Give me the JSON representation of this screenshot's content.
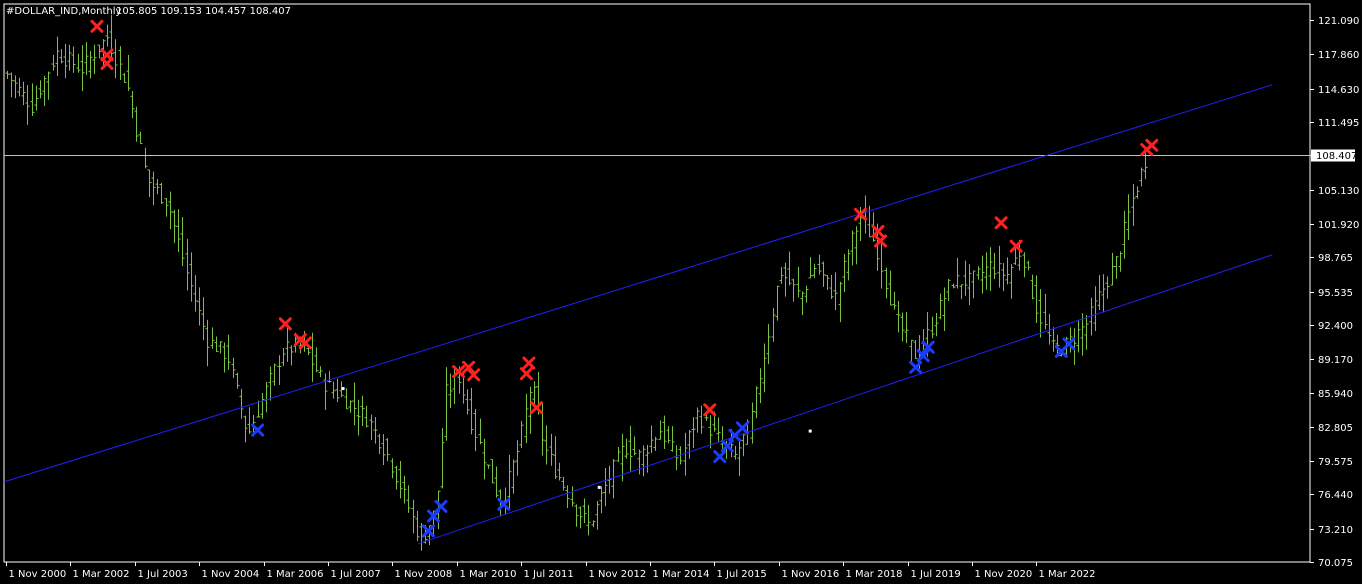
{
  "header": {
    "symbol": "#DOLLAR_IND,Monthly",
    "ohlc": "105.805 109.153 104.457 108.407"
  },
  "colors": {
    "background": "#000000",
    "frame": "#ffffff",
    "bar": "#7cc242",
    "channel": "#2020ff",
    "price_line": "#c0c0c0",
    "sell_marker": "#ff2020",
    "buy_marker": "#1a3cff",
    "anchor": "#ffffff"
  },
  "chart_data": {
    "type": "bar",
    "title": "#DOLLAR_IND,Monthly",
    "subtitle": "105.805 109.153 104.457 108.407",
    "ylim": [
      70.075,
      122.6
    ],
    "y_ticks": [
      "121.090",
      "117.860",
      "114.630",
      "111.495",
      "108.407",
      "105.130",
      "101.920",
      "98.765",
      "95.535",
      "92.400",
      "89.170",
      "85.940",
      "82.805",
      "79.575",
      "76.440",
      "73.210",
      "70.075"
    ],
    "x_ticks": [
      "1 Nov 2000",
      "1 Mar 2002",
      "1 Jul 2003",
      "1 Nov 2004",
      "1 Mar 2006",
      "1 Jul 2007",
      "1 Nov 2008",
      "1 Mar 2010",
      "1 Jul 2011",
      "1 Nov 2012",
      "1 Mar 2014",
      "1 Jul 2015",
      "1 Nov 2016",
      "1 Mar 2018",
      "1 Jul 2019",
      "1 Nov 2020",
      "1 Mar 2022"
    ],
    "current_price": 108.407,
    "price_path": [
      [
        2000.0,
        116.0
      ],
      [
        2000.5,
        113.0
      ],
      [
        2001.0,
        118.0
      ],
      [
        2001.5,
        116.5
      ],
      [
        2002.0,
        119.5
      ],
      [
        2002.4,
        115.0
      ],
      [
        2002.8,
        106.0
      ],
      [
        2003.2,
        104.0
      ],
      [
        2003.6,
        97.0
      ],
      [
        2004.0,
        91.0
      ],
      [
        2004.4,
        89.5
      ],
      [
        2004.8,
        82.0
      ],
      [
        2005.1,
        85.5
      ],
      [
        2005.5,
        90.0
      ],
      [
        2005.9,
        90.5
      ],
      [
        2006.3,
        87.0
      ],
      [
        2006.7,
        85.5
      ],
      [
        2007.2,
        83.5
      ],
      [
        2007.6,
        80.0
      ],
      [
        2007.9,
        76.5
      ],
      [
        2008.25,
        72.0
      ],
      [
        2008.55,
        75.0
      ],
      [
        2008.75,
        86.0
      ],
      [
        2009.0,
        87.5
      ],
      [
        2009.2,
        84.0
      ],
      [
        2009.5,
        80.0
      ],
      [
        2009.85,
        75.5
      ],
      [
        2010.2,
        81.0
      ],
      [
        2010.45,
        87.0
      ],
      [
        2010.7,
        81.0
      ],
      [
        2010.95,
        78.5
      ],
      [
        2011.35,
        75.0
      ],
      [
        2011.6,
        73.5
      ],
      [
        2011.9,
        77.0
      ],
      [
        2012.3,
        81.0
      ],
      [
        2012.6,
        80.0
      ],
      [
        2013.0,
        82.5
      ],
      [
        2013.4,
        79.5
      ],
      [
        2013.75,
        84.0
      ],
      [
        2014.2,
        81.5
      ],
      [
        2014.5,
        80.0
      ],
      [
        2014.8,
        83.0
      ],
      [
        2015.1,
        90.0
      ],
      [
        2015.4,
        97.5
      ],
      [
        2015.8,
        95.0
      ],
      [
        2016.1,
        98.0
      ],
      [
        2016.5,
        95.0
      ],
      [
        2016.8,
        100.0
      ],
      [
        2017.0,
        102.5
      ],
      [
        2017.3,
        100.0
      ],
      [
        2017.7,
        93.0
      ],
      [
        2018.1,
        89.5
      ],
      [
        2018.4,
        92.0
      ],
      [
        2018.8,
        96.5
      ],
      [
        2019.2,
        96.5
      ],
      [
        2019.6,
        98.0
      ],
      [
        2019.9,
        97.0
      ],
      [
        2020.2,
        99.5
      ],
      [
        2020.5,
        94.0
      ],
      [
        2020.85,
        90.0
      ],
      [
        2021.1,
        90.5
      ],
      [
        2021.5,
        92.5
      ],
      [
        2021.8,
        95.5
      ],
      [
        2022.1,
        98.5
      ],
      [
        2022.4,
        104.0
      ],
      [
        2022.7,
        108.4
      ]
    ],
    "channel_lines": [
      {
        "name": "upper",
        "from": [
          1999.4,
          76.8
        ],
        "to": [
          2025.2,
          115.0
        ]
      },
      {
        "name": "lower",
        "from": [
          2008.2,
          71.8
        ],
        "to": [
          2025.2,
          99.0
        ]
      }
    ],
    "channel_anchors": [
      [
        2006.7,
        86.4
      ],
      [
        2011.8,
        77.1
      ],
      [
        2016.0,
        82.4
      ]
    ],
    "sell_signals": [
      [
        2001.8,
        120.5
      ],
      [
        2002.0,
        117.8
      ],
      [
        2002.0,
        117.0
      ],
      [
        2005.55,
        92.5
      ],
      [
        2005.85,
        91.0
      ],
      [
        2005.95,
        90.7
      ],
      [
        2009.0,
        88.0
      ],
      [
        2009.2,
        88.4
      ],
      [
        2009.3,
        87.7
      ],
      [
        2010.35,
        87.8
      ],
      [
        2010.4,
        88.8
      ],
      [
        2010.55,
        84.6
      ],
      [
        2014.0,
        84.4
      ],
      [
        2017.0,
        102.8
      ],
      [
        2017.35,
        101.2
      ],
      [
        2017.4,
        100.3
      ],
      [
        2019.8,
        102.0
      ],
      [
        2020.1,
        99.8
      ],
      [
        2022.7,
        108.9
      ],
      [
        2022.8,
        109.3
      ]
    ],
    "buy_signals": [
      [
        2005.0,
        82.5
      ],
      [
        2008.4,
        73.0
      ],
      [
        2008.5,
        74.4
      ],
      [
        2008.65,
        75.3
      ],
      [
        2009.9,
        75.5
      ],
      [
        2014.2,
        80.0
      ],
      [
        2014.35,
        81.0
      ],
      [
        2014.5,
        82.0
      ],
      [
        2014.65,
        82.7
      ],
      [
        2018.1,
        88.4
      ],
      [
        2018.25,
        89.5
      ],
      [
        2018.35,
        90.3
      ],
      [
        2021.0,
        89.9
      ],
      [
        2021.15,
        90.6
      ]
    ]
  }
}
